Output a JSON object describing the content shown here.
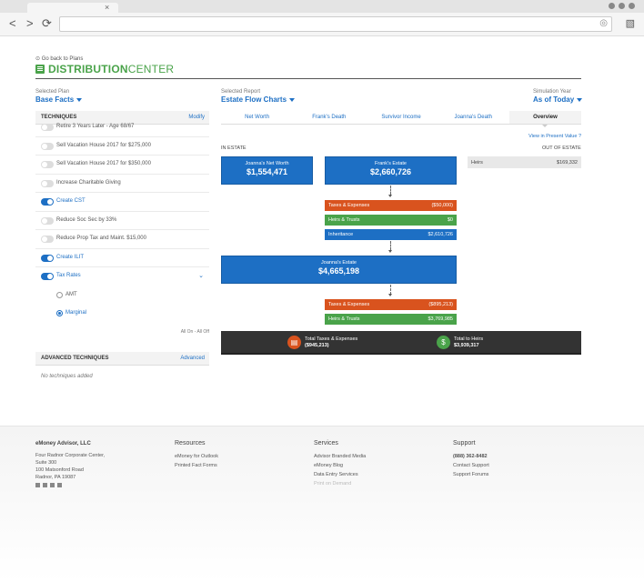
{
  "browser": {
    "tab_close": "×",
    "back": "<",
    "forward": ">",
    "reload": "⟳"
  },
  "header": {
    "back_link": "Go back to Plans",
    "logo_bold": "DISTRIBUTION",
    "logo_light": "CENTER"
  },
  "selectors": {
    "plan": {
      "label": "Selected Plan",
      "value": "Base Facts"
    },
    "report": {
      "label": "Selected Report",
      "value": "Estate Flow Charts"
    },
    "year": {
      "label": "Simulation Year",
      "value": "As of Today"
    }
  },
  "techniques": {
    "title": "TECHNIQUES",
    "action": "Modify",
    "items": [
      {
        "label": "Retire 3 Years Later - Age 68/67",
        "on": false
      },
      {
        "label": "Sell Vacation House 2017 for $275,000",
        "on": false
      },
      {
        "label": "Sell Vacation House 2017 for $350,000",
        "on": false
      },
      {
        "label": "Increase Charitable Giving",
        "on": false
      },
      {
        "label": "Create CST",
        "on": true
      },
      {
        "label": "Reduce Soc Sec by 33%",
        "on": false
      },
      {
        "label": "Reduce Prop Tax and Maint. $15,000",
        "on": false
      },
      {
        "label": "Create ILIT",
        "on": true
      },
      {
        "label": "Tax Rates",
        "on": true
      }
    ],
    "radios": [
      {
        "label": "AMT",
        "on": false
      },
      {
        "label": "Marginal",
        "on": true
      }
    ],
    "all_toggle": "All On - All Off"
  },
  "advanced": {
    "title": "ADVANCED TECHNIQUES",
    "action": "Advanced",
    "empty": "No techniques added"
  },
  "report_tabs": [
    {
      "label": "Net Worth",
      "active": false
    },
    {
      "label": "Frank's Death",
      "active": false
    },
    {
      "label": "Survivor Income",
      "active": false
    },
    {
      "label": "Joanna's Death",
      "active": false
    },
    {
      "label": "Overview",
      "active": true
    }
  ],
  "flow": {
    "in_estate": "IN ESTATE",
    "out_of_estate": "OUT OF ESTATE",
    "present_value_link": "View in Present Value",
    "joanna_net_worth": {
      "label": "Joanna's Net Worth",
      "value": "$1,554,471"
    },
    "franks_estate": {
      "label": "Frank's Estate",
      "value": "$2,660,726"
    },
    "frank_bars": [
      {
        "label": "Taxes & Expenses",
        "value": "($50,000)",
        "color": "#d9531e"
      },
      {
        "label": "Heirs & Trusts",
        "value": "$0",
        "color": "#4aa34a"
      },
      {
        "label": "Inheritance",
        "value": "$2,610,726",
        "color": "#1d6fc4"
      }
    ],
    "joannas_estate": {
      "label": "Joanna's Estate",
      "value": "$4,665,198"
    },
    "joanna_bars": [
      {
        "label": "Taxes & Expenses",
        "value": "($895,213)",
        "color": "#d9531e"
      },
      {
        "label": "Heirs & Trusts",
        "value": "$3,769,985",
        "color": "#4aa34a"
      }
    ],
    "heirs": {
      "label": "Heirs",
      "value": "$169,332"
    },
    "totals": {
      "taxes_label": "Total Taxes & Expenses",
      "taxes_value": "($945,213)",
      "heirs_label": "Total to Heirs",
      "heirs_value": "$3,939,317"
    }
  },
  "footer": {
    "company": {
      "name": "eMoney Advisor, LLC",
      "lines": [
        "Four Radnor Corporate Center,",
        "Suite 300",
        "100 Matsonford Road",
        "Radnor, PA 19087"
      ]
    },
    "resources": {
      "title": "Resources",
      "links": [
        "eMoney for Outlook",
        "Printed Fact Forms"
      ]
    },
    "services": {
      "title": "Services",
      "links": [
        "Advisor Branded Media",
        "eMoney Blog",
        "Data Entry Services",
        "Print on Demand"
      ]
    },
    "support": {
      "title": "Support",
      "phone": "(888) 362-8482",
      "links": [
        "Contact Support",
        "Support Forums"
      ]
    }
  }
}
